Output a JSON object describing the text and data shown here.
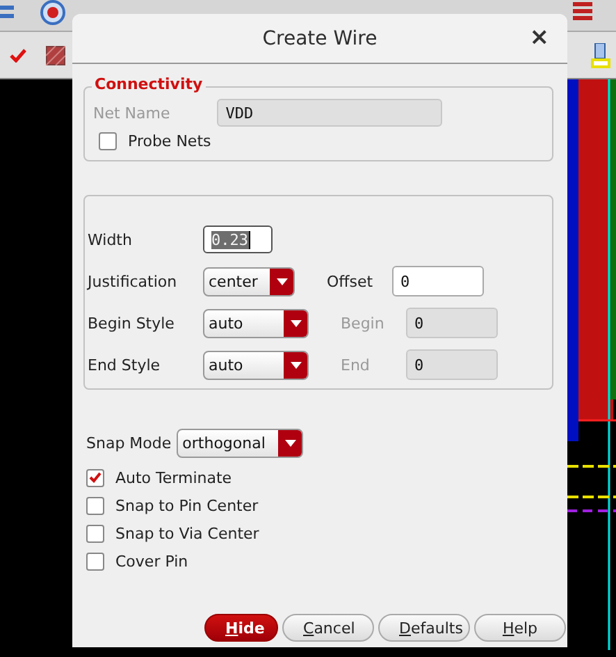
{
  "window": {
    "title": "Create Wire",
    "close": "×"
  },
  "connectivity": {
    "title": "Connectivity",
    "net_name": {
      "label": "Net Name",
      "value": "VDD",
      "disabled": true
    },
    "probe_nets": {
      "label": "Probe Nets",
      "checked": false
    }
  },
  "geometry": {
    "width": {
      "label": "Width",
      "value": "0.23",
      "text_selected": true
    },
    "rows": [
      {
        "label": "Justification",
        "select": "center",
        "field_label": "Offset",
        "field_value": "0",
        "disabled": false
      },
      {
        "label": "Begin Style",
        "select": "auto",
        "field_label": "Begin",
        "field_value": "0",
        "disabled": true
      },
      {
        "label": "End Style",
        "select": "auto",
        "field_label": "End",
        "field_value": "0",
        "disabled": true
      }
    ]
  },
  "snap_mode": {
    "label": "Snap Mode",
    "value": "orthogonal"
  },
  "options": [
    {
      "label": "Auto Terminate",
      "checked": true
    },
    {
      "label": "Snap to Pin Center",
      "checked": false
    },
    {
      "label": "Snap to Via Center",
      "checked": false
    },
    {
      "label": "Cover Pin",
      "checked": false
    }
  ],
  "buttons": [
    {
      "label": "Hide",
      "default": true
    },
    {
      "label": "Cancel",
      "default": false
    },
    {
      "label": "Defaults",
      "default": false
    },
    {
      "label": "Help",
      "default": false
    }
  ]
}
